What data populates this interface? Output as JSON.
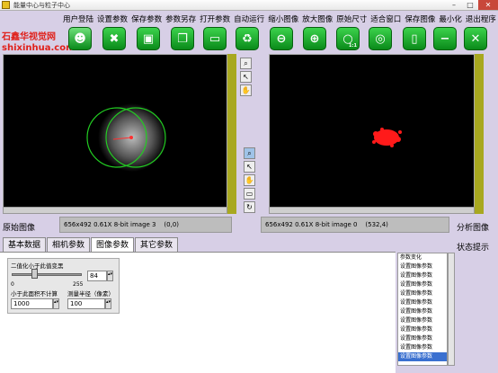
{
  "window": {
    "title": "能量中心与粒子中心"
  },
  "brand": {
    "name": "石鑫华视觉网",
    "url": "shixinhua.com"
  },
  "menu": [
    "用户登陆",
    "设置参数",
    "保存参数",
    "参数另存",
    "打开参数",
    "自动运行",
    "缩小图像",
    "放大图像",
    "原始尺寸",
    "适合窗口",
    "保存图像",
    "最小化",
    "退出程序"
  ],
  "toolbar": {
    "original_size_badge": "1:1"
  },
  "left_panel": {
    "label": "原始图像",
    "status": "656x492 0.61X 8-bit image 3    (0,0)"
  },
  "right_panel": {
    "label": "分析图像",
    "status": "656x492 0.61X 8-bit image 0    (532,4)"
  },
  "tabs": [
    {
      "label": "基本数据"
    },
    {
      "label": "相机参数"
    },
    {
      "label": "图像参数",
      "active": true
    },
    {
      "label": "其它参数"
    }
  ],
  "image_params": {
    "binarize_label": "二值化小于此值变黑",
    "slider_min": "0",
    "slider_max": "255",
    "slider_value": "84",
    "ignore_label": "小于此面积不计算",
    "ignore_value": "1000",
    "radius_label": "测量半径（像素）",
    "radius_value": "100"
  },
  "status_hint": {
    "label": "状态提示",
    "items": [
      "参数变化",
      "设置图像参数",
      "设置图像参数",
      "设置图像参数",
      "设置图像参数",
      "设置图像参数",
      "设置图像参数",
      "设置图像参数",
      "设置图像参数",
      "设置图像参数",
      "设置图像参数",
      "设置图像参数"
    ]
  }
}
